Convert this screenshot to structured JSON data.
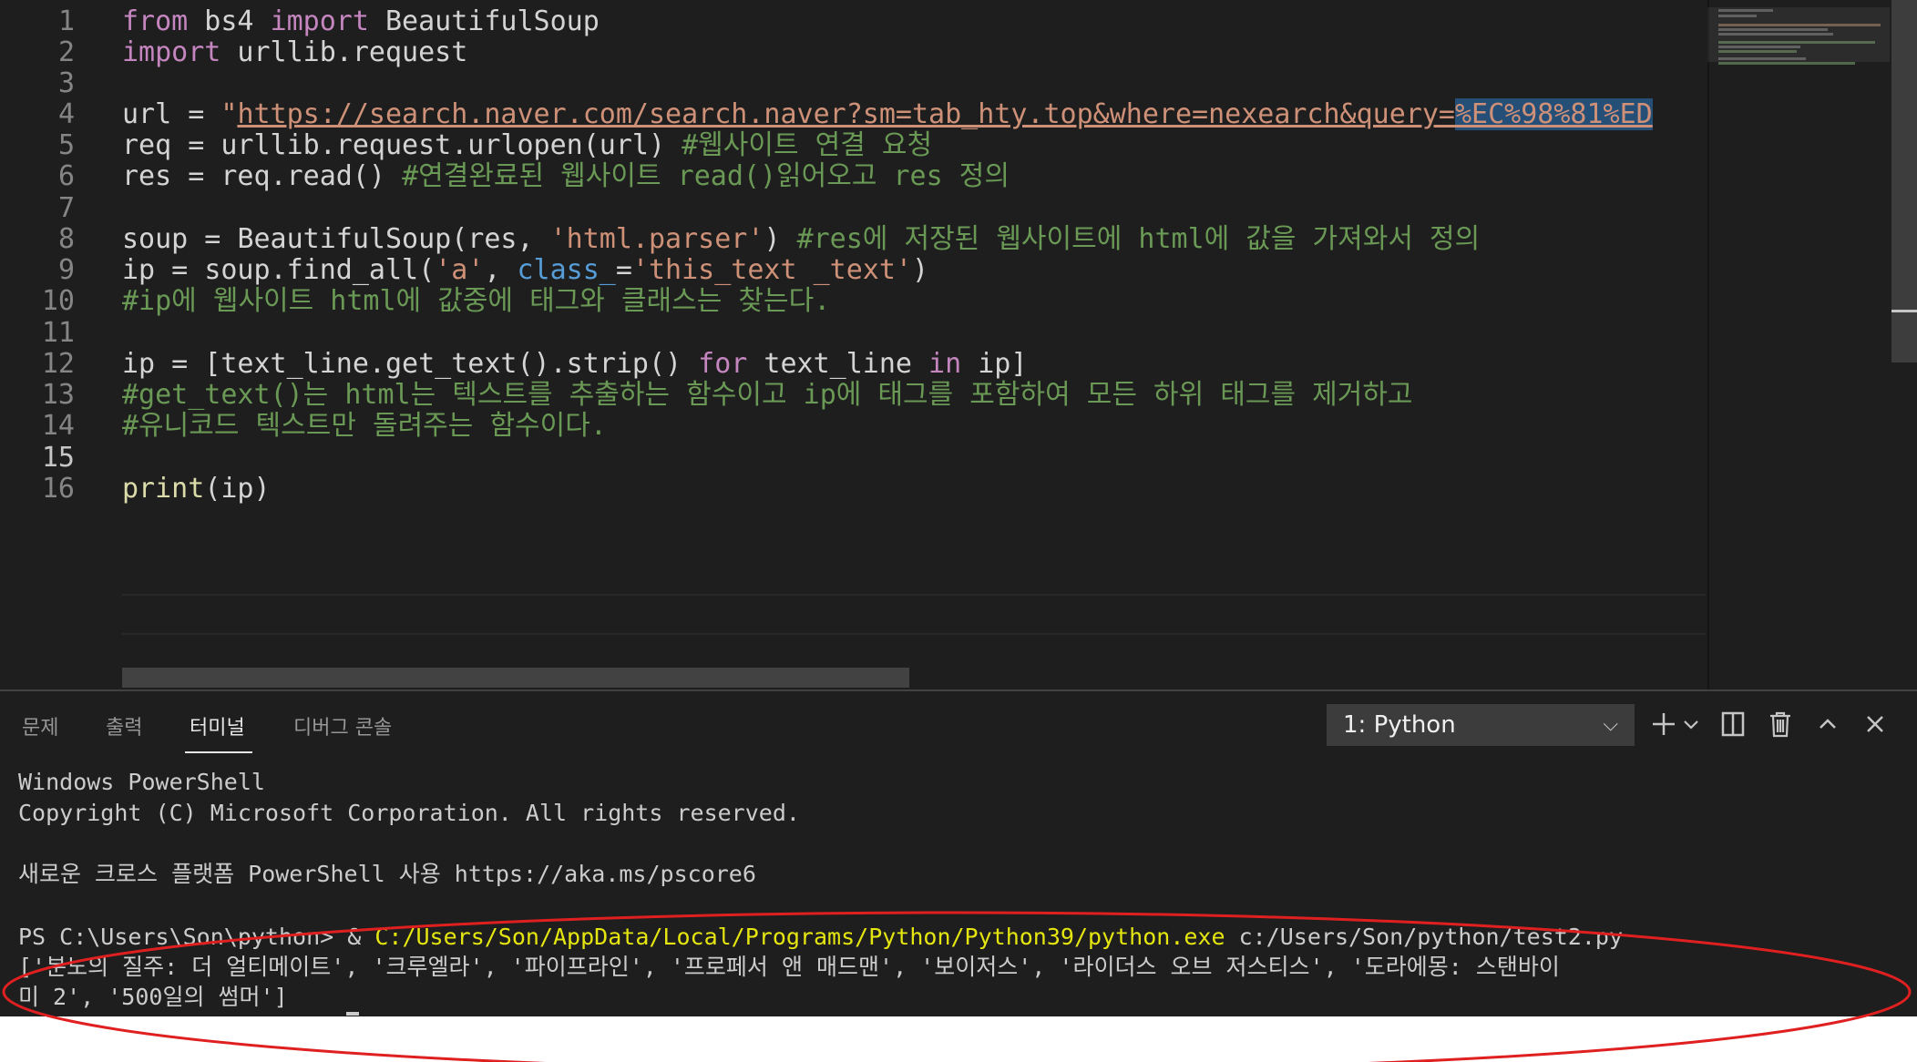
{
  "editor": {
    "line_numbers": [
      "1",
      "2",
      "3",
      "4",
      "5",
      "6",
      "7",
      "8",
      "9",
      "10",
      "11",
      "12",
      "13",
      "14",
      "15",
      "16"
    ],
    "active_line": "15",
    "lines": {
      "l1": {
        "kw1": "from",
        "mod": " bs4 ",
        "kw2": "import",
        "name": " BeautifulSoup"
      },
      "l2": {
        "kw": "import",
        "rest": " urllib.request"
      },
      "l4": {
        "var": "url",
        "eq": " = ",
        "quote": "\"",
        "url_text": "https://search.naver.com/search.naver?sm=tab_hty.top&where=nexearch&query=",
        "url_enc": "%EC%98%81%ED"
      },
      "l5": {
        "var": "req",
        "eq": " = ",
        "call": "urllib.request.urlopen(url) ",
        "comment": "#웹사이트 연결 요청"
      },
      "l6": {
        "var": "res",
        "eq": " = ",
        "call": "req.read() ",
        "comment": "#연결완료된 웹사이트 read()읽어오고 res 정의"
      },
      "l8": {
        "var": "soup",
        "eq": " = ",
        "fn": "BeautifulSoup",
        "args_a": "(res, ",
        "str": "'html.parser'",
        "args_b": ") ",
        "comment": "#res에 저장된 웹사이트에 html에 값을 가져와서 정의"
      },
      "l9": {
        "var": "ip",
        "eq": " = ",
        "call": "soup.find_all(",
        "str1": "'a'",
        "comma": ", ",
        "kw": "class_",
        "eq2": "=",
        "str2": "'this_text _text'",
        "close": ")"
      },
      "l10": {
        "comment": "#ip에 웹사이트 html에 값중에 태그와 클래스는 찾는다."
      },
      "l12": {
        "var": "ip",
        "eq": " = [",
        "body": "text_line.get_text().strip() ",
        "kw1": "for",
        "mid": " text_line ",
        "kw2": "in",
        "end": " ip]"
      },
      "l13": {
        "comment": "#get_text()는 html는 텍스트를 추출하는 함수이고 ip에 태그를 포함하여 모든 하위 태그를 제거하고"
      },
      "l14": {
        "comment": "#유니코드 텍스트만 돌려주는 함수이다."
      },
      "l16": {
        "fn": "print",
        "args": "(ip)"
      }
    }
  },
  "panel": {
    "tabs": [
      {
        "label": "문제"
      },
      {
        "label": "출력"
      },
      {
        "label": "터미널",
        "active": true
      },
      {
        "label": "디버그 콘솔"
      }
    ],
    "terminal_select": "1: Python",
    "icons": [
      "plus-icon",
      "chevron-down-icon",
      "split-icon",
      "trash-icon",
      "chevron-up-icon",
      "close-icon"
    ]
  },
  "terminal": {
    "l1": "Windows PowerShell",
    "l2": "Copyright (C) Microsoft Corporation. All rights reserved.",
    "l3": "새로운 크로스 플랫폼 PowerShell 사용 https://aka.ms/pscore6",
    "prompt": "PS C:\\Users\\Son\\python> & ",
    "exe": "C:/Users/Son/AppData/Local/Programs/Python/Python39/python.exe",
    "script": " c:/Users/Son/python/test2.py",
    "out1": "['분노의 질주: 더 얼티메이트', '크루엘라', '파이프라인', '프로페서 앤 매드맨', '보이저스', '라이더스 오브 저스티스', '도라에몽: 스탠바이",
    "out2": "미 2', '500일의 썸머']"
  },
  "colors": {
    "editor_bg": "#1e1e1e",
    "keyword": "#c586c0",
    "string": "#ce9178",
    "comment": "#6a9955",
    "function": "#dcdcaa",
    "variable": "#9cdcfe",
    "terminal_yellow": "#e5e510",
    "annotation_red": "#e02020"
  }
}
